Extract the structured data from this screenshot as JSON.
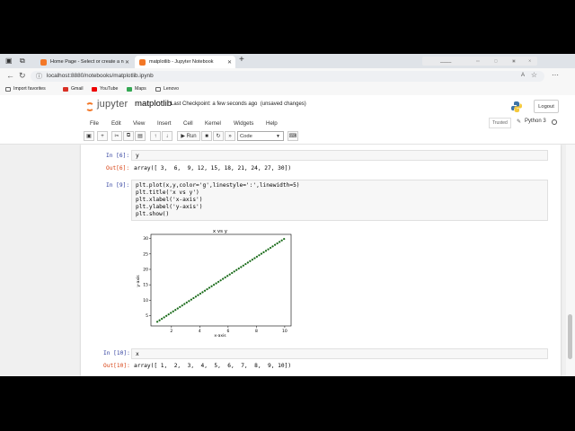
{
  "browser": {
    "tabs": [
      {
        "title": "Home Page - Select or create a n",
        "close": "✕"
      },
      {
        "title": "matplotlib - Jupyter Notebook",
        "close": "✕"
      }
    ],
    "new_tab": "+",
    "url": "localhost:8880/notebooks/matplotlib.ipynb",
    "bookmarks": [
      "Import favorites",
      "Gmail",
      "YouTube",
      "Maps",
      "Lenovo"
    ]
  },
  "jupyter": {
    "logo_text": "jupyter",
    "notebook_name": "matplotlib",
    "checkpoint": "Last Checkpoint: a few seconds ago",
    "unsaved": "(unsaved changes)",
    "logout": "Logout",
    "menu": [
      "File",
      "Edit",
      "View",
      "Insert",
      "Cell",
      "Kernel",
      "Widgets",
      "Help"
    ],
    "trusted": "Trusted",
    "kernel": "Python 3",
    "toolbar": {
      "run": "Run",
      "cell_type": "Code"
    }
  },
  "cells": [
    {
      "in_prompt": "In [6]:",
      "code": [
        "y"
      ],
      "out_prompt": "Out[6]:",
      "output": "array([ 3,  6,  9, 12, 15, 18, 21, 24, 27, 30])"
    },
    {
      "in_prompt": "In [9]:",
      "code": [
        "plt.plot(x,y,color='g',linestyle=':',linewidth=5)",
        "plt.title('x vs y')",
        "plt.xlabel('x-axis')",
        "plt.ylabel('y-axis')",
        "plt.show()"
      ]
    },
    {
      "in_prompt": "In [10]:",
      "code": [
        "x"
      ],
      "out_prompt": "Out[10]:",
      "output": "array([ 1,  2,  3,  4,  5,  6,  7,  8,  9, 10])"
    }
  ],
  "chart_data": {
    "type": "line",
    "title": "x vs y",
    "xlabel": "x-axis",
    "ylabel": "y-axis",
    "x": [
      1,
      2,
      3,
      4,
      5,
      6,
      7,
      8,
      9,
      10
    ],
    "series": [
      {
        "values": [
          3,
          6,
          9,
          12,
          15,
          18,
          21,
          24,
          27,
          30
        ],
        "color": "#1a6b1a",
        "linestyle": "dotted"
      }
    ],
    "xticks": [
      "2",
      "4",
      "6",
      "8",
      "10"
    ],
    "yticks": [
      "5",
      "10",
      "15",
      "20",
      "25",
      "30"
    ],
    "xlim": [
      0.55,
      10.45
    ],
    "ylim": [
      1.65,
      31.35
    ],
    "grid": false
  }
}
